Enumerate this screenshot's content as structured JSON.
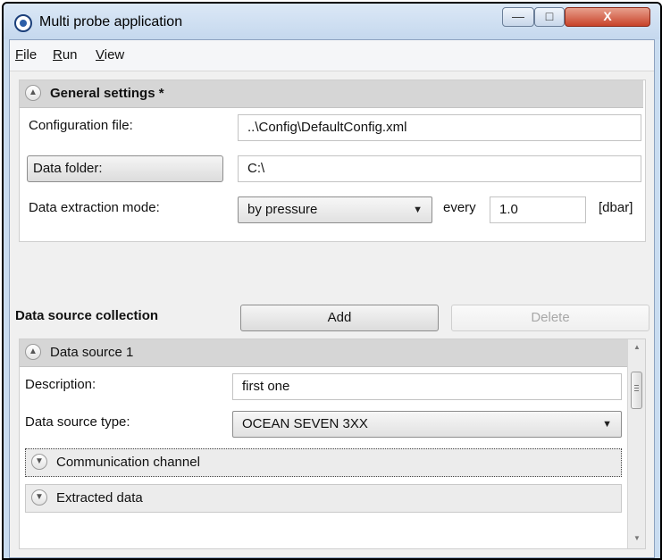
{
  "window": {
    "title": "Multi probe application"
  },
  "window_controls": {
    "minimize": "—",
    "maximize": "□",
    "close": "X"
  },
  "menu": {
    "items": [
      {
        "access_key": "F",
        "rest": "ile"
      },
      {
        "access_key": "R",
        "rest": "un"
      },
      {
        "access_key": "V",
        "rest": "iew"
      }
    ]
  },
  "general_settings": {
    "header": "General settings *",
    "configuration_file_label": "Configuration file:",
    "configuration_file_value": "..\\Config\\DefaultConfig.xml",
    "data_folder_button": "Data folder:",
    "data_folder_value": "C:\\",
    "extraction_mode_label": "Data extraction mode:",
    "extraction_mode_value": "by pressure",
    "every_label": "every",
    "every_value": "1.0",
    "unit": "[dbar]"
  },
  "data_source_collection": {
    "title": "Data source collection",
    "add_button": "Add",
    "delete_button": "Delete",
    "sources": [
      {
        "header": "Data source 1",
        "description_label": "Description:",
        "description_value": "first one",
        "type_label": "Data source type:",
        "type_value": "OCEAN SEVEN 3XX",
        "sections": [
          "Communication channel",
          "Extracted data"
        ]
      }
    ]
  },
  "icons": {
    "collapse": "chevron-up-icon",
    "expand": "chevron-down-icon",
    "dropdown": "dropdown-arrow-icon"
  }
}
